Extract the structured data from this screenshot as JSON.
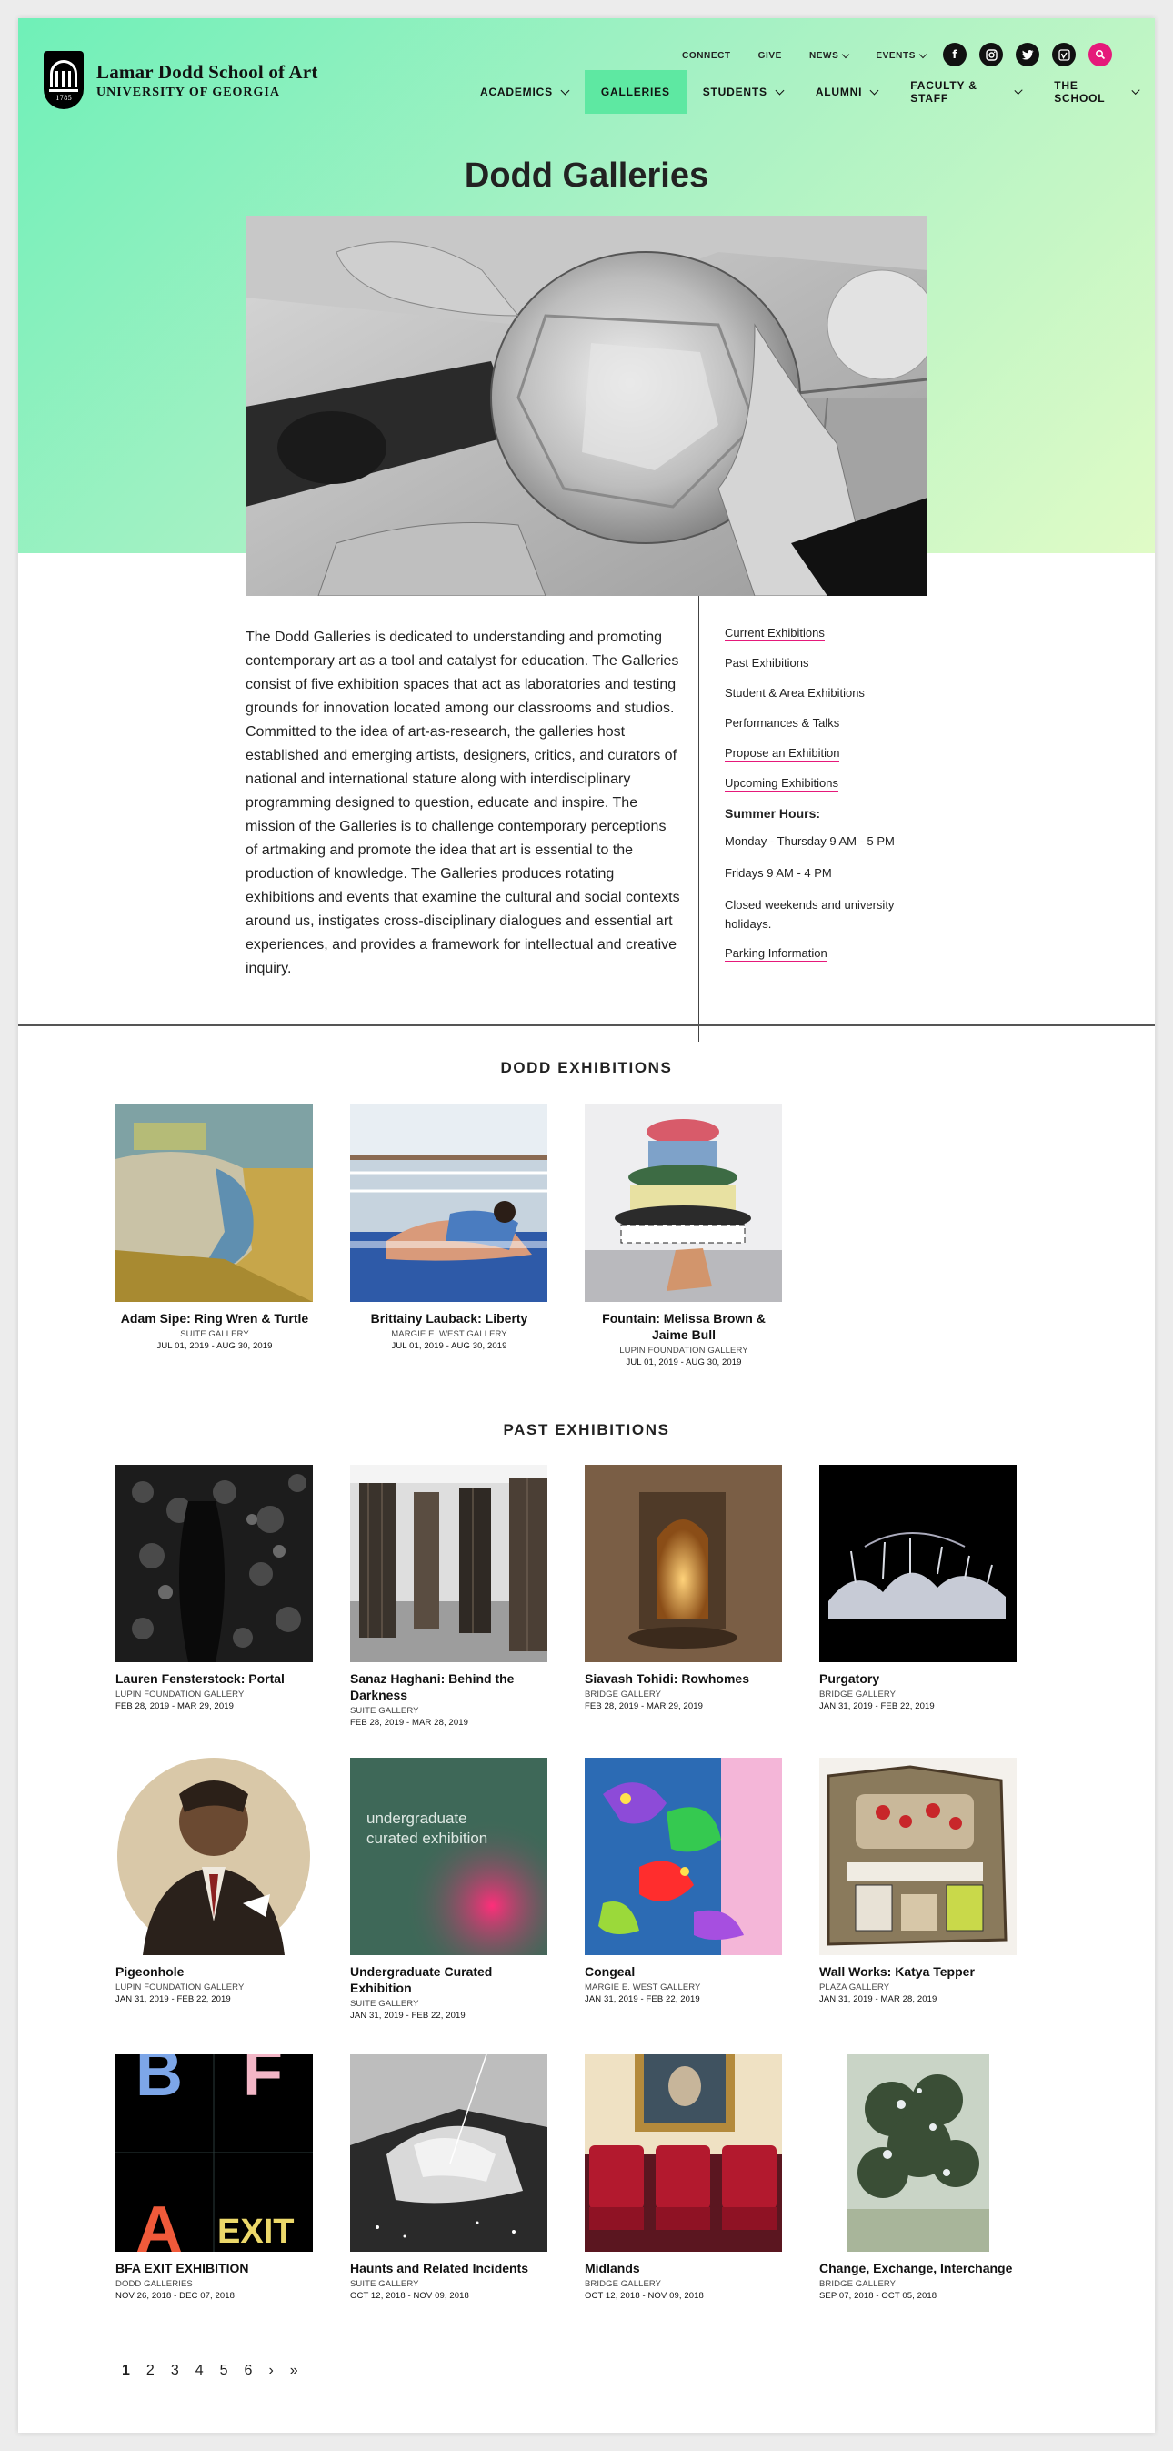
{
  "header": {
    "school_name": "Lamar Dodd School of Art",
    "university": "UNIVERSITY OF GEORGIA",
    "seal_year": "1785",
    "utility_nav": [
      {
        "label": "CONNECT",
        "dropdown": false
      },
      {
        "label": "GIVE",
        "dropdown": false
      },
      {
        "label": "NEWS",
        "dropdown": true
      },
      {
        "label": "EVENTS",
        "dropdown": true
      }
    ],
    "social": [
      "facebook-icon",
      "instagram-icon",
      "twitter-icon",
      "vimeo-icon",
      "search-icon"
    ],
    "main_nav": [
      {
        "label": "ACADEMICS",
        "active": false
      },
      {
        "label": "GALLERIES",
        "active": true
      },
      {
        "label": "STUDENTS",
        "active": false
      },
      {
        "label": "ALUMNI",
        "active": false
      },
      {
        "label": "FACULTY & STAFF",
        "active": false
      },
      {
        "label": "THE SCHOOL",
        "active": false
      }
    ]
  },
  "page": {
    "title": "Dodd Galleries",
    "intro": "The Dodd Galleries is dedicated to understanding and promoting contemporary art as a tool and catalyst for education. The Galleries consist of five exhibition spaces that act as laboratories and testing grounds for innovation located among our classrooms and studios. Committed to the idea of art-as-research, the galleries host established and emerging artists, designers, critics, and curators of national and international stature along with interdisciplinary programming designed to question, educate and inspire. The mission of the Galleries is to challenge contemporary perceptions of artmaking and promote the idea that art is essential to the production of knowledge. The Galleries produces rotating exhibitions and events that examine the cultural and social contexts around us, instigates cross-disciplinary dialogues and essential art experiences, and provides a framework for intellectual and creative inquiry."
  },
  "sidebar": {
    "links": [
      "Current Exhibitions",
      "Past Exhibitions",
      "Student & Area Exhibitions",
      "Performances & Talks",
      "Propose an Exhibition",
      "Upcoming Exhibitions"
    ],
    "hours_heading": "Summer Hours:",
    "hours": [
      "Monday - Thursday 9 AM - 5 PM",
      "Fridays 9 AM - 4 PM",
      "Closed weekends and university holidays."
    ],
    "parking": "Parking Information"
  },
  "dodd_exhibitions": {
    "heading": "DODD EXHIBITIONS",
    "items": [
      {
        "title": "Adam Sipe: Ring Wren & Turtle",
        "gallery": "SUITE GALLERY",
        "dates": "JUL 01, 2019 - AUG 30, 2019"
      },
      {
        "title": "Brittainy Lauback: Liberty",
        "gallery": "MARGIE E. WEST GALLERY",
        "dates": "JUL 01, 2019 - AUG 30, 2019"
      },
      {
        "title": "Fountain: Melissa Brown & Jaime Bull",
        "gallery": "LUPIN FOUNDATION GALLERY",
        "dates": "JUL 01, 2019 - AUG 30, 2019"
      }
    ]
  },
  "past_exhibitions": {
    "heading": "PAST EXHIBITIONS",
    "items": [
      {
        "title": "Lauren Fensterstock: Portal",
        "gallery": "LUPIN FOUNDATION GALLERY",
        "dates": "FEB 28, 2019 - MAR 29, 2019"
      },
      {
        "title": "Sanaz Haghani: Behind the Darkness",
        "gallery": "SUITE GALLERY",
        "dates": "FEB 28, 2019 - MAR 28, 2019"
      },
      {
        "title": "Siavash Tohidi: Rowhomes",
        "gallery": "BRIDGE GALLERY",
        "dates": "FEB 28, 2019 - MAR 29, 2019"
      },
      {
        "title": "Purgatory",
        "gallery": "BRIDGE GALLERY",
        "dates": "JAN 31, 2019 - FEB 22, 2019"
      },
      {
        "title": "Pigeonhole",
        "gallery": "LUPIN FOUNDATION GALLERY",
        "dates": "JAN 31, 2019 - FEB 22, 2019"
      },
      {
        "title": "Undergraduate Curated Exhibition",
        "gallery": "SUITE GALLERY",
        "dates": "JAN 31, 2019 - FEB 22, 2019",
        "thumb_text": "undergraduate curated exhibition"
      },
      {
        "title": "Congeal",
        "gallery": "MARGIE E. WEST GALLERY",
        "dates": "JAN 31, 2019 - FEB 22, 2019"
      },
      {
        "title": "Wall Works: Katya Tepper",
        "gallery": "PLAZA GALLERY",
        "dates": "JAN 31, 2019 - MAR 28, 2019"
      },
      {
        "title": "BFA EXIT EXHIBITION",
        "gallery": "DODD GALLERIES",
        "dates": "NOV 26, 2018 - DEC 07, 2018",
        "thumb_letters": [
          "B",
          "F",
          "A",
          "EXIT"
        ]
      },
      {
        "title": "Haunts and Related Incidents",
        "gallery": "SUITE GALLERY",
        "dates": "OCT 12, 2018 - NOV 09, 2018"
      },
      {
        "title": "Midlands",
        "gallery": "BRIDGE GALLERY",
        "dates": "OCT 12, 2018 - NOV 09, 2018"
      },
      {
        "title": "Change, Exchange, Interchange",
        "gallery": "BRIDGE GALLERY",
        "dates": "SEP 07, 2018 - OCT 05, 2018"
      }
    ]
  },
  "pagination": {
    "pages": [
      "1",
      "2",
      "3",
      "4",
      "5",
      "6"
    ],
    "current": "1",
    "next": "›",
    "last": "»"
  }
}
